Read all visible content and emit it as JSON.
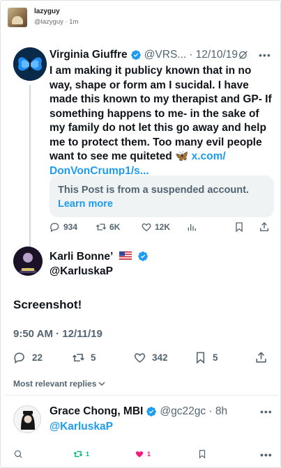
{
  "outer_post": {
    "name": "lazyguy",
    "handle_time": "@lazyguy · 1m"
  },
  "quoted_tweet": {
    "author_name": "Virginia Giuffre",
    "handle": "@VRS...",
    "date": "· 12/10/19",
    "body_lines": [
      "I am making it publicy known that in no",
      "way, shape or form am I sucidal. I have",
      "made this known to my therapist and GP- If",
      "something happens to me- in the sake of",
      "my family do not let this go away and help",
      "me to protect them. Too many evil people",
      "want to see me quiteted 🦋"
    ],
    "link_part1": "x.com/",
    "link_part2": "DonVonCrump1/s...",
    "suspended_message": "This Post is from a suspended account.",
    "learn_more": "Learn more",
    "stats": {
      "replies": "934",
      "reposts": "6K",
      "likes": "12K"
    }
  },
  "main_tweet": {
    "author_name": "Karli Bonne’",
    "handle": "@KarluskaP",
    "text": "Screenshot!",
    "timestamp": "9:50 AM · 12/11/19",
    "stats": {
      "replies": "22",
      "reposts": "5",
      "likes": "342",
      "bookmarks": "5"
    }
  },
  "replies_sort": "Most relevant replies",
  "reply": {
    "author_name": "Grace Chong, MBI",
    "handle_time": "@gc22gc · 8h",
    "mention": "@KarluskaP",
    "stats": {
      "reposts": "1",
      "likes": "1"
    }
  },
  "colors": {
    "accent": "#1d9bf0",
    "text": "#0f1419",
    "muted": "#536471",
    "repost_active": "#00ba7c",
    "like_active": "#f91880"
  }
}
